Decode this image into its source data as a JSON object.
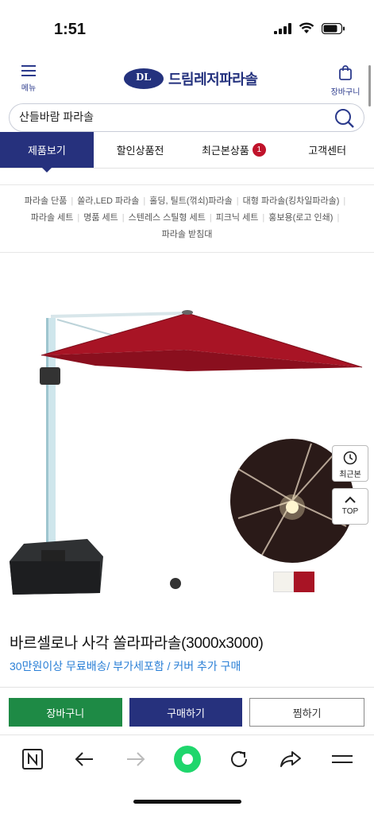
{
  "status": {
    "time": "1:51",
    "icons": [
      "signal-icon",
      "wifi-icon",
      "battery-icon"
    ]
  },
  "header": {
    "menu_label": "메뉴",
    "logo_mark": "DL",
    "logo_text": "드림레저파라솔",
    "cart_label": "장바구니"
  },
  "search": {
    "value": "산들바람 파라솔",
    "placeholder": ""
  },
  "tabs": [
    {
      "label": "제품보기",
      "active": true
    },
    {
      "label": "할인상품전"
    },
    {
      "label": "최근본상품",
      "badge": "1"
    },
    {
      "label": "고객센터"
    }
  ],
  "categories": {
    "row1": [
      "파라솔 단품",
      "쏠라,LED 파라솔",
      "홀딩, 틸트(꺾쇠)파라솔",
      "대형 파라솔(킹차일파라솔)"
    ],
    "row2": [
      "파라솔 세트",
      "명품 세트",
      "스텐레스 스틸형 세트",
      "피크닉 세트",
      "홍보용(로고 인쇄)"
    ],
    "row3": [
      "파라솔 받침대"
    ]
  },
  "floating": {
    "recent_label": "최근본",
    "top_label": "TOP"
  },
  "swatches": [
    "#f4f2ec",
    "#a81425"
  ],
  "product": {
    "title": "바르셀로나 사각 쏠라파라솔(3000x3000)",
    "subtitle": "30만원이상 무료배송/ 부가세포함 / 커버 추가 구매"
  },
  "actions": {
    "cart": "장바구니",
    "buy": "구매하기",
    "wish": "찜하기"
  },
  "colors": {
    "brand": "#26317d",
    "cart_green": "#1e8a45",
    "umbrella_red": "#a81425",
    "link_blue": "#2a7fd6"
  }
}
